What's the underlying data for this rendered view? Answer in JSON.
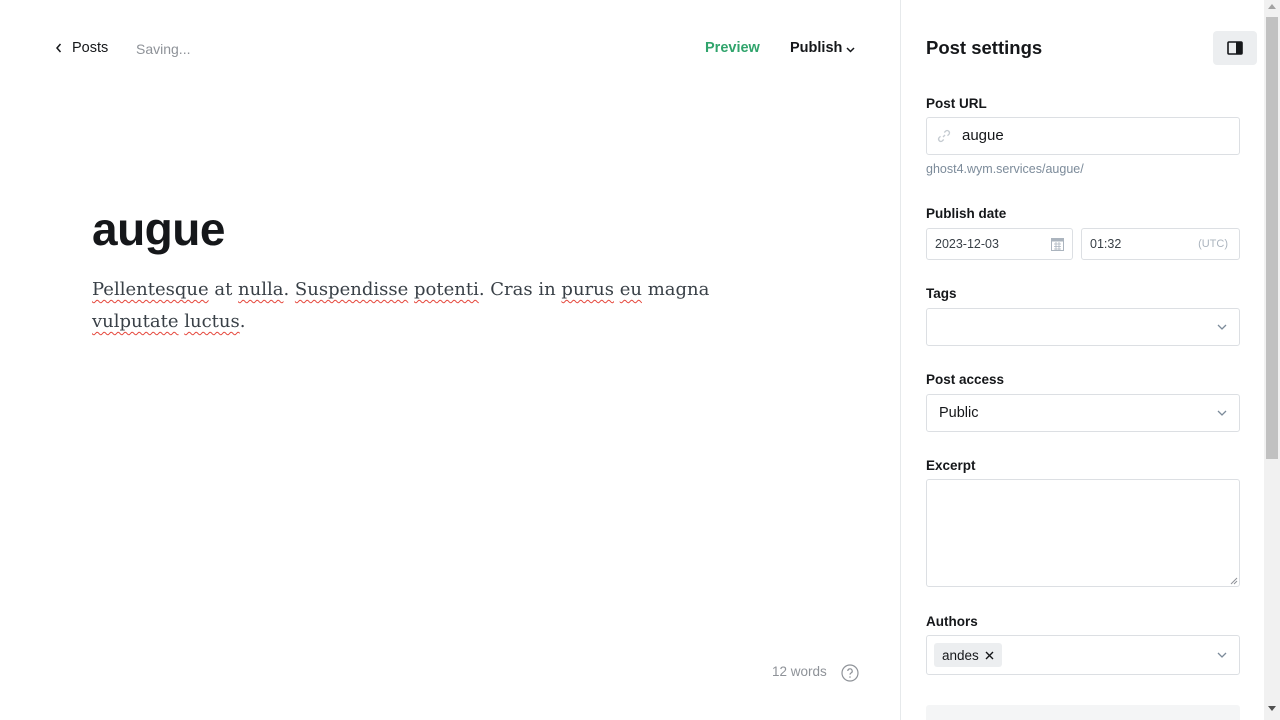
{
  "header": {
    "back_label": "Posts",
    "status": "Saving...",
    "preview_label": "Preview",
    "publish_label": "Publish"
  },
  "post": {
    "title": "augue",
    "body": [
      {
        "text": "Pellentesque",
        "misspelled": true
      },
      {
        "text": " at ",
        "misspelled": false
      },
      {
        "text": "nulla",
        "misspelled": true
      },
      {
        "text": ". ",
        "misspelled": false
      },
      {
        "text": "Suspendisse",
        "misspelled": true
      },
      {
        "text": " ",
        "misspelled": false
      },
      {
        "text": "potenti",
        "misspelled": true
      },
      {
        "text": ". Cras in ",
        "misspelled": false
      },
      {
        "text": "purus",
        "misspelled": true
      },
      {
        "text": " ",
        "misspelled": false
      },
      {
        "text": "eu",
        "misspelled": true
      },
      {
        "text": " magna ",
        "misspelled": false
      },
      {
        "text": "vulputate",
        "misspelled": true
      },
      {
        "text": " ",
        "misspelled": false
      },
      {
        "text": "luctus",
        "misspelled": true
      },
      {
        "text": ".",
        "misspelled": false
      }
    ],
    "word_count": "12 words"
  },
  "settings": {
    "title": "Post settings",
    "url_label": "Post URL",
    "url_value": "augue",
    "url_hint": "ghost4.wym.services/augue/",
    "publish_date_label": "Publish date",
    "date_value": "2023-12-03",
    "time_value": "01:32",
    "timezone": "(UTC)",
    "tags_label": "Tags",
    "access_label": "Post access",
    "access_value": "Public",
    "excerpt_label": "Excerpt",
    "excerpt_value": "",
    "authors_label": "Authors",
    "authors": [
      "andes"
    ]
  },
  "colors": {
    "accent_green": "#30a46c",
    "spellcheck_red": "#e5453a"
  }
}
